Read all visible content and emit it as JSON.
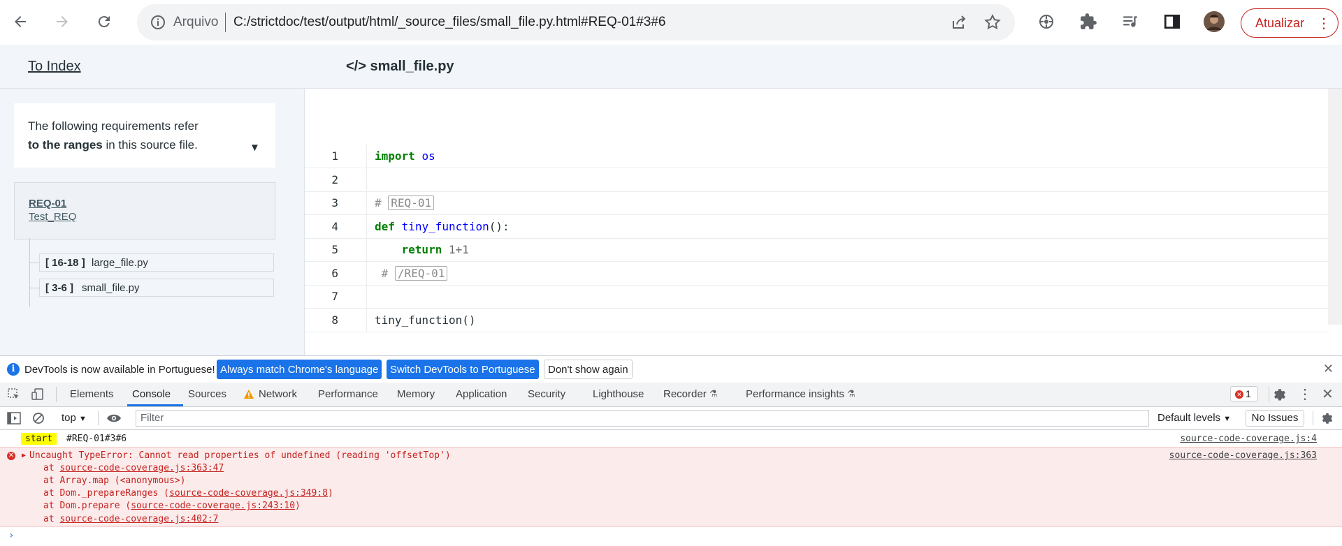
{
  "browser": {
    "url_scheme": "Arquivo",
    "url": "C:/strictdoc/test/output/html/_source_files/small_file.py.html#REQ-01#3#6",
    "update_label": "Atualizar"
  },
  "header": {
    "to_index": "To Index",
    "file_title": "</> small_file.py"
  },
  "aside": {
    "intro_line1": "The following requirements refer",
    "intro_bold": "to the ranges",
    "intro_rest": " in this source file.",
    "toggle": "▼",
    "requirement": {
      "uid": "REQ-01",
      "title": "Test_REQ"
    },
    "ranges": [
      {
        "range": "[ 16-18 ]",
        "file": "large_file.py"
      },
      {
        "range": "[ 3-6 ]",
        "file": "small_file.py"
      }
    ]
  },
  "code": {
    "line_numbers": [
      "1",
      "2",
      "3",
      "4",
      "5",
      "6",
      "7",
      "8"
    ],
    "import_kw": "import",
    "import_name": "os",
    "comment_hash": "#",
    "req_marker": "REQ-01",
    "def_kw": "def",
    "func_name": "tiny_function",
    "func_sig_rest": "():",
    "return_kw": "return",
    "return_val": "1+1",
    "end_marker": "/REQ-01",
    "call": "tiny_function()"
  },
  "devtools": {
    "lang_msg": "DevTools is now available in Portuguese!",
    "btn_match": "Always match Chrome's language",
    "btn_switch": "Switch DevTools to Portuguese",
    "btn_dismiss": "Don't show again",
    "tabs": [
      "Elements",
      "Console",
      "Sources",
      "Network",
      "Performance",
      "Memory",
      "Application",
      "Security",
      "Lighthouse",
      "Recorder",
      "Performance insights"
    ],
    "error_count": "1",
    "context": "top",
    "filter_placeholder": "Filter",
    "levels": "Default levels",
    "issues": "No Issues"
  },
  "console": {
    "log_tag": "start",
    "log_value": "#REQ-01#3#6",
    "log_source": "source-code-coverage.js:4",
    "error_message": "Uncaught TypeError: Cannot read properties of undefined (reading 'offsetTop')",
    "error_source": "source-code-coverage.js:363",
    "stack": [
      {
        "prefix": "at ",
        "link": "source-code-coverage.js:363:47",
        "suffix": ""
      },
      {
        "prefix": "at Array.map (<anonymous>)",
        "link": "",
        "suffix": ""
      },
      {
        "prefix": "at Dom._prepareRanges (",
        "link": "source-code-coverage.js:349:8",
        "suffix": ")"
      },
      {
        "prefix": "at Dom.prepare (",
        "link": "source-code-coverage.js:243:10",
        "suffix": ")"
      },
      {
        "prefix": "at ",
        "link": "source-code-coverage.js:402:7",
        "suffix": ""
      }
    ]
  }
}
